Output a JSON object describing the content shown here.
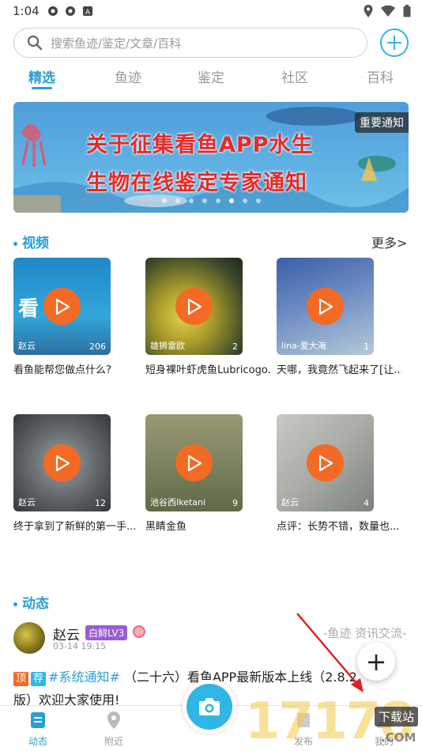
{
  "status": {
    "time": "1:04"
  },
  "search": {
    "placeholder": "搜索鱼迹/鉴定/文章/百科"
  },
  "tabs": [
    {
      "label": "精选"
    },
    {
      "label": "鱼迹"
    },
    {
      "label": "鉴定"
    },
    {
      "label": "社区"
    },
    {
      "label": "百科"
    }
  ],
  "banner": {
    "line1": "关于征集看鱼APP水生",
    "line2": "生物在线鉴定专家通知",
    "tag": "重要通知"
  },
  "videos_section": {
    "title": "视频",
    "more": "更多>"
  },
  "videos": [
    {
      "author": "赵云",
      "count": "206",
      "title": "看鱼能帮您做点什么?",
      "thumb_text": "看"
    },
    {
      "author": "雄狮雷欧",
      "count": "2",
      "title": "短身裸叶虾虎鱼Lubricogo..."
    },
    {
      "author": "lina-爱大海",
      "count": "1",
      "title": "天哪，我竟然飞起来了[让..."
    },
    {
      "author": "赵云",
      "count": "12",
      "title": "终于拿到了新鲜的第一手..."
    },
    {
      "author": "池谷西Iketani",
      "count": "9",
      "title": "黑睛金鱼"
    },
    {
      "author": "赵云",
      "count": "4",
      "title": "点评：长势不错，数量也..."
    }
  ],
  "feed_section": {
    "title": "动态"
  },
  "post": {
    "user": "赵云",
    "level": "白鲟LV3",
    "time": "03-14 19:15",
    "category": "-鱼迹 资讯交流-",
    "chip_top": "顶",
    "chip_rec": "荐",
    "topic": "#系统通知#",
    "text": "（二十六）看鱼APP最新版本上线（2.8.2版）欢迎大家使用!"
  },
  "fab": {
    "label": "+"
  },
  "bottom_nav": [
    {
      "label": "动态"
    },
    {
      "label": "附近"
    },
    {
      "label": "发布"
    },
    {
      "label": "我的"
    }
  ],
  "watermark": {
    "text": "17178",
    "sub": "下载站",
    "domain": ".COM"
  },
  "colors": {
    "accent": "#2a9fd6",
    "play": "#f26a24",
    "banner_text": "#e52b2b"
  }
}
